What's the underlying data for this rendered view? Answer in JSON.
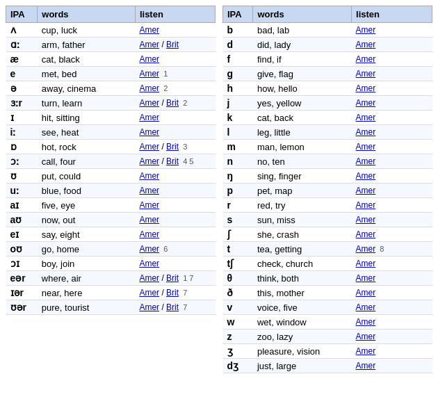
{
  "leftTable": {
    "headers": [
      "IPA",
      "words",
      "listen"
    ],
    "rows": [
      {
        "ipa": "ʌ",
        "words": "cup, luck",
        "wordUnderline": "",
        "listen": "Amer",
        "britLink": false,
        "note": ""
      },
      {
        "ipa": "ɑː",
        "words": "arm, father",
        "listen": "Amer / Brit",
        "britLink": true,
        "note": ""
      },
      {
        "ipa": "æ",
        "words": "cat, black",
        "listen": "Amer",
        "britLink": false,
        "note": ""
      },
      {
        "ipa": "e",
        "words": "met, bed",
        "listen": "Amer",
        "britLink": false,
        "note": "1"
      },
      {
        "ipa": "ə",
        "words": "away, cinema",
        "listen": "Amer",
        "britLink": false,
        "note": "2"
      },
      {
        "ipa": "ɜːr",
        "words": "turn, learn",
        "listen": "Amer / Brit",
        "britLink": true,
        "note": "2"
      },
      {
        "ipa": "ɪ",
        "words": "hit, sitting",
        "listen": "Amer",
        "britLink": false,
        "note": ""
      },
      {
        "ipa": "iː",
        "words": "see, heat",
        "listen": "Amer",
        "britLink": false,
        "note": ""
      },
      {
        "ipa": "ɒ",
        "words": "hot, rock",
        "listen": "Amer / Brit",
        "britLink": true,
        "note": "3"
      },
      {
        "ipa": "ɔː",
        "words": "call, four",
        "listen": "Amer / Brit",
        "britLink": true,
        "note": "4 5"
      },
      {
        "ipa": "ʊ",
        "words": "put, could",
        "listen": "Amer",
        "britLink": false,
        "note": ""
      },
      {
        "ipa": "uː",
        "words": "blue, food",
        "listen": "Amer",
        "britLink": false,
        "note": ""
      },
      {
        "ipa": "aɪ",
        "words": "five, eye",
        "listen": "Amer",
        "britLink": false,
        "note": ""
      },
      {
        "ipa": "aʊ",
        "words": "now, out",
        "listen": "Amer",
        "britLink": false,
        "note": ""
      },
      {
        "ipa": "eɪ",
        "words": "say, eight",
        "listen": "Amer",
        "britLink": false,
        "note": ""
      },
      {
        "ipa": "oʊ",
        "words": "go, home",
        "listen": "Amer",
        "britLink": false,
        "note": "6"
      },
      {
        "ipa": "ɔɪ",
        "words": "boy, join",
        "listen": "Amer",
        "britLink": false,
        "note": ""
      },
      {
        "ipa": "eər",
        "words": "where, air",
        "listen": "Amer / Brit",
        "britLink": true,
        "note": "1 7"
      },
      {
        "ipa": "ɪər",
        "words": "near, here",
        "listen": "Amer / Brit",
        "britLink": true,
        "note": "7"
      },
      {
        "ipa": "ʊər",
        "words": "pure, tourist",
        "listen": "Amer / Brit",
        "britLink": true,
        "note": "7"
      }
    ]
  },
  "rightTable": {
    "headers": [
      "IPA",
      "words",
      "listen"
    ],
    "rows": [
      {
        "ipa": "b",
        "words": "bad, lab",
        "listen": "Amer",
        "britLink": false,
        "note": ""
      },
      {
        "ipa": "d",
        "words": "did, lady",
        "listen": "Amer",
        "britLink": false,
        "note": ""
      },
      {
        "ipa": "f",
        "words": "find, if",
        "listen": "Amer",
        "britLink": false,
        "note": ""
      },
      {
        "ipa": "g",
        "words": "give, flag",
        "listen": "Amer",
        "britLink": false,
        "note": ""
      },
      {
        "ipa": "h",
        "words": "how, hello",
        "listen": "Amer",
        "britLink": false,
        "note": ""
      },
      {
        "ipa": "j",
        "words": "yes, yellow",
        "listen": "Amer",
        "britLink": false,
        "note": ""
      },
      {
        "ipa": "k",
        "words": "cat, back",
        "listen": "Amer",
        "britLink": false,
        "note": ""
      },
      {
        "ipa": "l",
        "words": "leg, little",
        "listen": "Amer",
        "britLink": false,
        "note": ""
      },
      {
        "ipa": "m",
        "words": "man, lemon",
        "listen": "Amer",
        "britLink": false,
        "note": ""
      },
      {
        "ipa": "n",
        "words": "no, ten",
        "listen": "Amer",
        "britLink": false,
        "note": ""
      },
      {
        "ipa": "ŋ",
        "words": "sing, finger",
        "listen": "Amer",
        "britLink": false,
        "note": ""
      },
      {
        "ipa": "p",
        "words": "pet, map",
        "listen": "Amer",
        "britLink": false,
        "note": ""
      },
      {
        "ipa": "r",
        "words": "red, try",
        "listen": "Amer",
        "britLink": false,
        "note": ""
      },
      {
        "ipa": "s",
        "words": "sun, miss",
        "listen": "Amer",
        "britLink": false,
        "note": ""
      },
      {
        "ipa": "ʃ",
        "words": "she, crash",
        "listen": "Amer",
        "britLink": false,
        "note": ""
      },
      {
        "ipa": "t",
        "words": "tea, getting",
        "listen": "Amer",
        "britLink": false,
        "note": "8"
      },
      {
        "ipa": "tʃ",
        "words": "check, church",
        "listen": "Amer",
        "britLink": false,
        "note": ""
      },
      {
        "ipa": "θ",
        "words": "think, both",
        "listen": "Amer",
        "britLink": false,
        "note": ""
      },
      {
        "ipa": "ð",
        "words": "this, mother",
        "listen": "Amer",
        "britLink": false,
        "note": ""
      },
      {
        "ipa": "v",
        "words": "voice, five",
        "listen": "Amer",
        "britLink": false,
        "note": ""
      },
      {
        "ipa": "w",
        "words": "wet, window",
        "listen": "Amer",
        "britLink": false,
        "note": ""
      },
      {
        "ipa": "z",
        "words": "zoo, lazy",
        "listen": "Amer",
        "britLink": false,
        "note": ""
      },
      {
        "ipa": "ʒ",
        "words": "pleasure, vision",
        "listen": "Amer",
        "britLink": false,
        "note": ""
      },
      {
        "ipa": "dʒ",
        "words": "just, large",
        "listen": "Amer",
        "britLink": false,
        "note": ""
      }
    ]
  }
}
